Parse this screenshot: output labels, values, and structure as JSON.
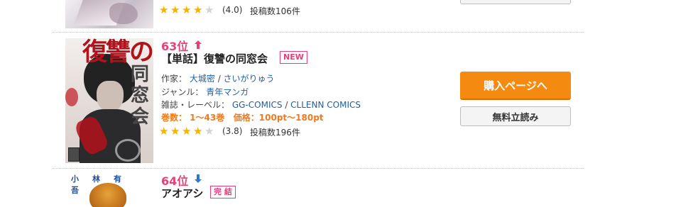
{
  "items": [
    {
      "rating": 4.0,
      "rating_text": "(4.0)",
      "reviews": "投稿数106件",
      "cover_icon": "manga-cover-image"
    },
    {
      "rank": "63位",
      "rank_trend": "up",
      "rank_trend_color": "#e8407a",
      "title": "【単話】復讐の同窓会",
      "badge": "NEW",
      "author_label": "作家：",
      "authors": [
        "大城密",
        "さいがりゅう"
      ],
      "genre_label": "ジャンル：",
      "genre": "青年マンガ",
      "label_label": "雑誌・レーベル：",
      "labels": [
        "GG-COMICS",
        "CLLENN COMICS"
      ],
      "volumes": "巻数： 1〜43巻",
      "price": "価格：100pt〜180pt",
      "rating": 3.8,
      "rating_text": "(3.8)",
      "reviews": "投稿数196件",
      "buy_button": "購入ページへ",
      "free_button": "無料立読み",
      "cover_title": "復讐の",
      "cover_title_vertical": "同窓会"
    },
    {
      "rank": "64位",
      "rank_trend": "down",
      "rank_trend_color": "#2a78d6",
      "title": "アオアシ",
      "badge": "完 結",
      "cover_author": "小林有吾"
    }
  ],
  "colors": {
    "rank": "#e8407a",
    "buy_button": "#f58a11",
    "link": "#1f5fa8",
    "star": "#f6b300",
    "highlight": "#f07a1f"
  }
}
